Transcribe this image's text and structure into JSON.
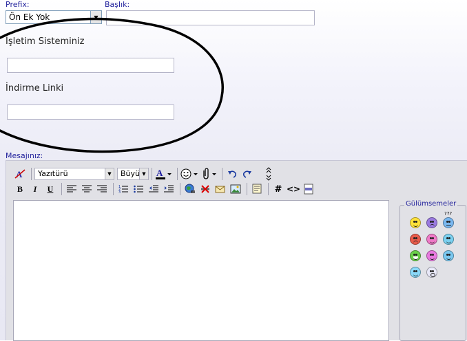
{
  "header": {
    "prefix_label": "Prefix:",
    "prefix_value": "Ön Ek Yok",
    "title_label": "Başlık:",
    "title_value": ""
  },
  "fields": [
    {
      "label": "İşletim Sisteminiz",
      "value": ""
    },
    {
      "label": "İndirme Linki",
      "value": ""
    }
  ],
  "message": {
    "label": "Mesajınız:",
    "font_select": "Yazıtürü",
    "size_select": "Büyük",
    "text": ""
  },
  "smilies": {
    "title": "Gülümsemeler",
    "confused_text": "???",
    "items": [
      "smile",
      "frown",
      "confused",
      "mad",
      "tongue",
      "cool-blue",
      "grin",
      "wink",
      "rolleyes",
      "sunglasses",
      "eek"
    ]
  },
  "colors": {
    "label_blue": "#22229C",
    "circle": "#000000"
  }
}
